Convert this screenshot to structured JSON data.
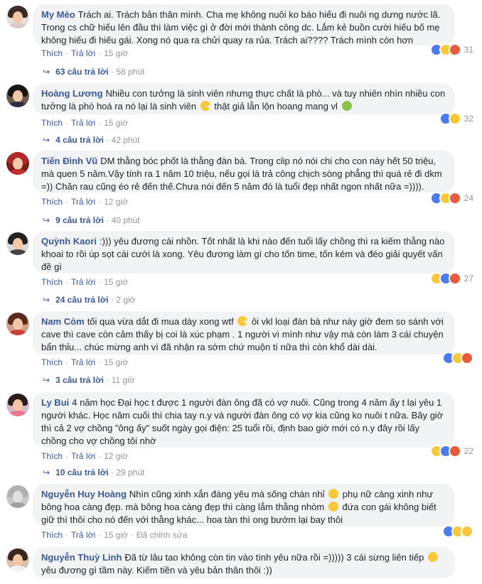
{
  "comments": [
    {
      "author": "My Mèo",
      "text": "Trách ai. Trách bản thân mình. Cha mẹ không nuôi ko báo hiếu đi nuôi ng dưng nước lã. Trong cs chữ hiếu lên đầu thì làm việc gì ở đời mới thành công dc. Lắm kẻ buồn cười hiếu bố mẹ không hiếu đi hiếu gái. Xong nó qua ra chửi quay ra rủa. Trách ai???? Trách mình còn hơn",
      "like": "Thích",
      "reply": "Trả lời",
      "time": "15 giờ",
      "reactions": "31",
      "replies": "63 câu trả lời",
      "reply_time": "58 phút"
    },
    {
      "author": "Hoàng Lương",
      "text_a": "Nhiều con tưởng là sinh viên nhưng thực chất là phò... và tuy nhiên nhìn nhiều con tưởng là phò hoá ra nó lại là sinh viên",
      "text_b": "thật giả lẫn lộn hoang mang vl",
      "like": "Thích",
      "reply": "Trả lời",
      "time": "15 giờ",
      "reactions": "32",
      "replies": "4 câu trả lời",
      "reply_time": "42 phút"
    },
    {
      "author": "Tiến Đình Vũ",
      "text": "DM thằng bóc phốt là thằng đàn bà. Trong clip nó nói chi cho con này hết 50 triệu, mà quen 5 năm.Vậy tính ra 1 năm 10 triệu, nếu gọi là trả công chịch sòng phẳng thì quá rẻ đi dkm =)) Chăn rau cũng éo rẻ đến thế.Chưa nói đến 5 năm đó là tuổi đẹp nhất ngon nhất nữa =)))).",
      "like": "Thích",
      "reply": "Trả lời",
      "time": "12 giờ",
      "reactions": "24",
      "replies": "9 câu trả lời",
      "reply_time": "40 phút"
    },
    {
      "author": "Quỳnh Kaori",
      "text": ":))) yêu đương cái nhồn. Tốt nhất là khi nào đến tuổi lấy chồng thì ra kiếm thằng nào khoai to rồi úp sọt cái cưới là xong. Yêu đương làm gì cho tốn time, tốn kém và đéo giải quyết vấn đề gì",
      "like": "Thích",
      "reply": "Trả lời",
      "time": "15 giờ",
      "reactions": "27",
      "replies": "24 câu trả lời",
      "reply_time": "2 giờ"
    },
    {
      "author": "Nam Còm",
      "text_a": "tối qua vừa dắt đi mua dày xong wtf",
      "text_b": "ôi vkl loại đàn bà như này giờ đem so sánh với cave thì cave còn cảm thấy bị coi là xúc phạm . 1 người vì mình như vậy mà còn làm 3 cái chuyện bẩn thỉu... chúc mừng anh vì đã nhận ra sớm chứ muộn tí nữa thì còn khổ dài dài.",
      "like": "Thích",
      "reply": "Trả lời",
      "time": "15 giờ",
      "reactions": "",
      "replies": "3 câu trả lời",
      "reply_time": "11 giờ"
    },
    {
      "author": "Ly Bui",
      "text": "4 năm học Đại học t được 1 người đàn ông đã có vợ nuôi. Cũng trong 4 năm ấy t lại yêu 1 người khác. Học năm cuối thì chia tay n.y và người đàn ông có vợ kia cũng ko nuôi t nữa. Bây giờ thì cả 2 vợ chồng \"ông ấy\" suốt ngày gọi điện: 25 tuổi rồi, định bao giờ mới có n.y đây rồi lấy chồng cho vợ chồng tôi nhờ",
      "like": "Thích",
      "reply": "Trả lời",
      "time": "12 giờ",
      "reactions": "22",
      "replies": "10 câu trả lời",
      "reply_time": "29 phút"
    },
    {
      "author": "Nguyễn Huy Hoàng",
      "text_a": "Nhìn cũng xinh xắn đáng yêu mà sống chán nhỉ",
      "text_b": "phụ nữ càng xinh như bông hoa càng đẹp. mà bông hoa càng đẹp thì càng lắm thằng nhòm",
      "text_c": "đứa con gái không biết giữ thì thôi cho nó đến với thằng khác... hoa tàn thì ong bướm lại bay thôi",
      "like": "Thích",
      "reply": "Trả lời",
      "time": "15 giờ",
      "edited": "Đã chỉnh sửa",
      "reactions": ""
    },
    {
      "author": "Nguyễn Thuỳ Linh",
      "text_a": "Đã từ lâu tao không còn tin vào tình yêu nữa rồi =))))) 3 cái sừng liên tiếp",
      "text_b": "yêu đương gì tầm này. Kiếm tiền và yêu bản thân thôi :))"
    }
  ]
}
